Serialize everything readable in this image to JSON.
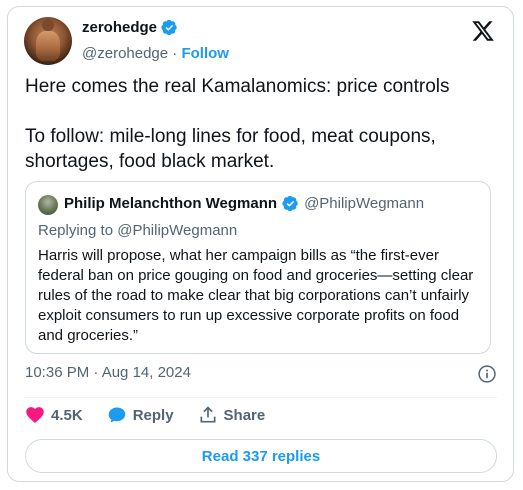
{
  "author": {
    "display_name": "zerohedge",
    "handle": "@zerohedge",
    "separator": "·",
    "follow_label": "Follow"
  },
  "tweet": {
    "line1": "Here comes the real Kamalanomics: price controls",
    "line2": "To follow: mile-long lines for food, meat coupons, shortages, food black market."
  },
  "quote": {
    "display_name": "Philip Melanchthon Wegmann",
    "handle": "@PhilipWegmann",
    "replying_to": "Replying to @PhilipWegmann",
    "text": "Harris will propose, what her campaign bills as “the first-ever federal ban on price gouging on food and groceries—setting clear rules of the road to make clear that big corporations can’t unfairly exploit consumers to run up excessive corporate profits on food and groceries.”"
  },
  "timestamp": "10:36 PM · Aug 14, 2024",
  "actions": {
    "like_count": "4.5K",
    "reply_label": "Reply",
    "share_label": "Share"
  },
  "read_replies_label": "Read 337 replies",
  "colors": {
    "accent": "#1d9bf0",
    "like": "#f91880",
    "secondary_text": "#536471",
    "border": "#cfd9de"
  },
  "icons": [
    "verified-badge-icon",
    "x-logo-icon",
    "info-icon",
    "heart-icon",
    "reply-bubble-icon",
    "share-icon"
  ]
}
